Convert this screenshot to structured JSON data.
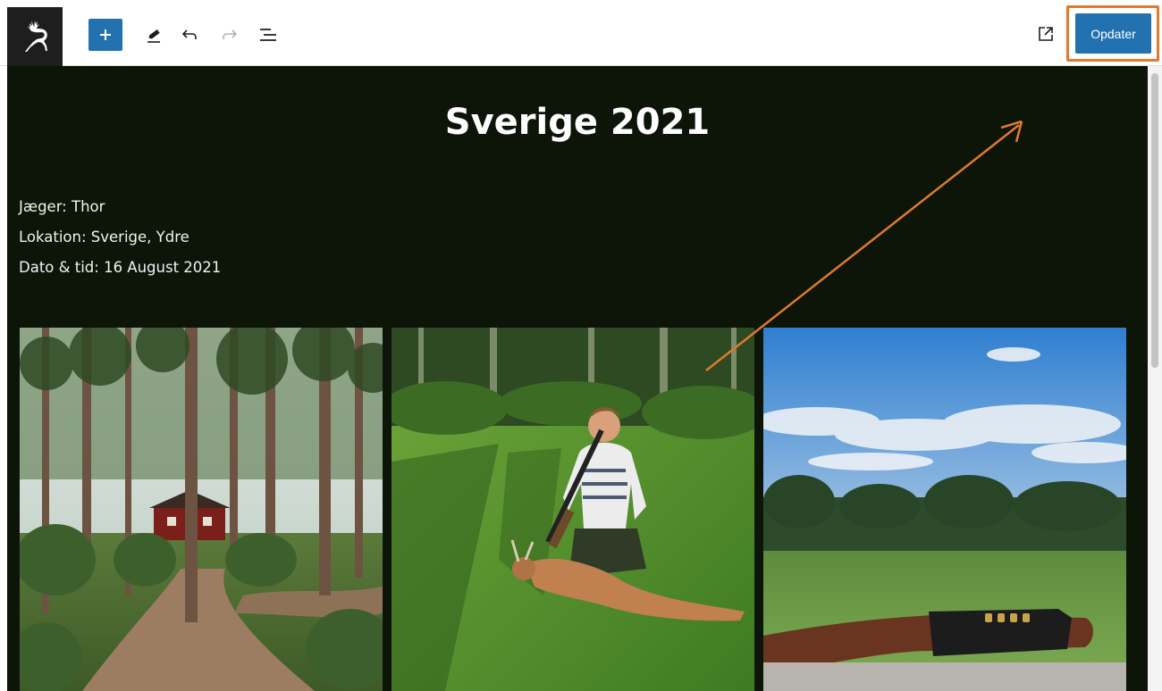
{
  "toolbar": {
    "logo_icon": "leaping-deer-icon",
    "add_icon": "plus-icon",
    "tools_icon": "pencil-icon",
    "undo_icon": "undo-icon",
    "redo_icon": "redo-icon",
    "outline_icon": "list-view-icon",
    "preview_icon": "external-link-icon",
    "update_label": "Opdater"
  },
  "post": {
    "title": "Sverige 2021",
    "hunter": "Jæger: Thor",
    "location": "Lokation: Sverige, Ydre",
    "date": "Dato & tid: 16 August 2021"
  },
  "gallery": [
    {
      "subject": "forest-cabin-photo"
    },
    {
      "subject": "hunter-with-deer-photo"
    },
    {
      "subject": "field-and-rifle-photo"
    }
  ],
  "colors": {
    "accent": "#2271b1",
    "highlight": "#e07a2e",
    "canvas_bg": "#0c1508"
  }
}
